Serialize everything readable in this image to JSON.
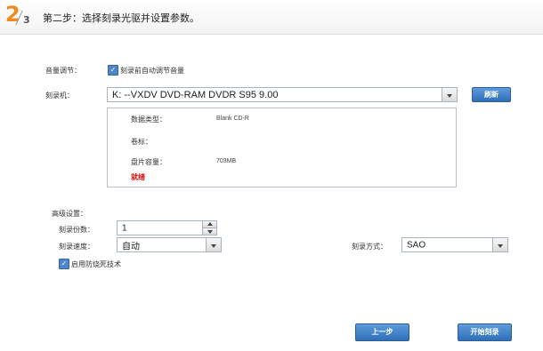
{
  "header": {
    "step_current": "2",
    "step_total": "3",
    "title": "第二步：选择刻录光驱并设置参数。"
  },
  "volume": {
    "label": "音量调节：",
    "auto_adjust_checked": true,
    "auto_adjust_label": "刻录前自动调节音量"
  },
  "burner": {
    "label": "刻录机：",
    "selected": "K:  --VXDV      DVD-RAM DVDR S95 9.00",
    "refresh_label": "刷新"
  },
  "disc_info": {
    "type_label": "数据类型：",
    "type_value": "Blank CD-R",
    "volume_label": "卷标：",
    "volume_value": "",
    "capacity_label": "盘片容量：",
    "capacity_value": "703MB",
    "status": "就绪"
  },
  "advanced": {
    "label": "高级设置：",
    "copies_label": "刻录份数：",
    "copies_value": "1",
    "speed_label": "刻录速度：",
    "speed_value": "自动",
    "mode_label": "刻录方式：",
    "mode_value": "SAO",
    "protect_checked": true,
    "protect_label": "启用防烧死技术"
  },
  "footer": {
    "prev_label": "上一步",
    "start_label": "开始刻录"
  },
  "colors": {
    "accent_orange": "#f08a1c",
    "button_blue": "#3a7cc4",
    "status_red": "#d01010"
  }
}
